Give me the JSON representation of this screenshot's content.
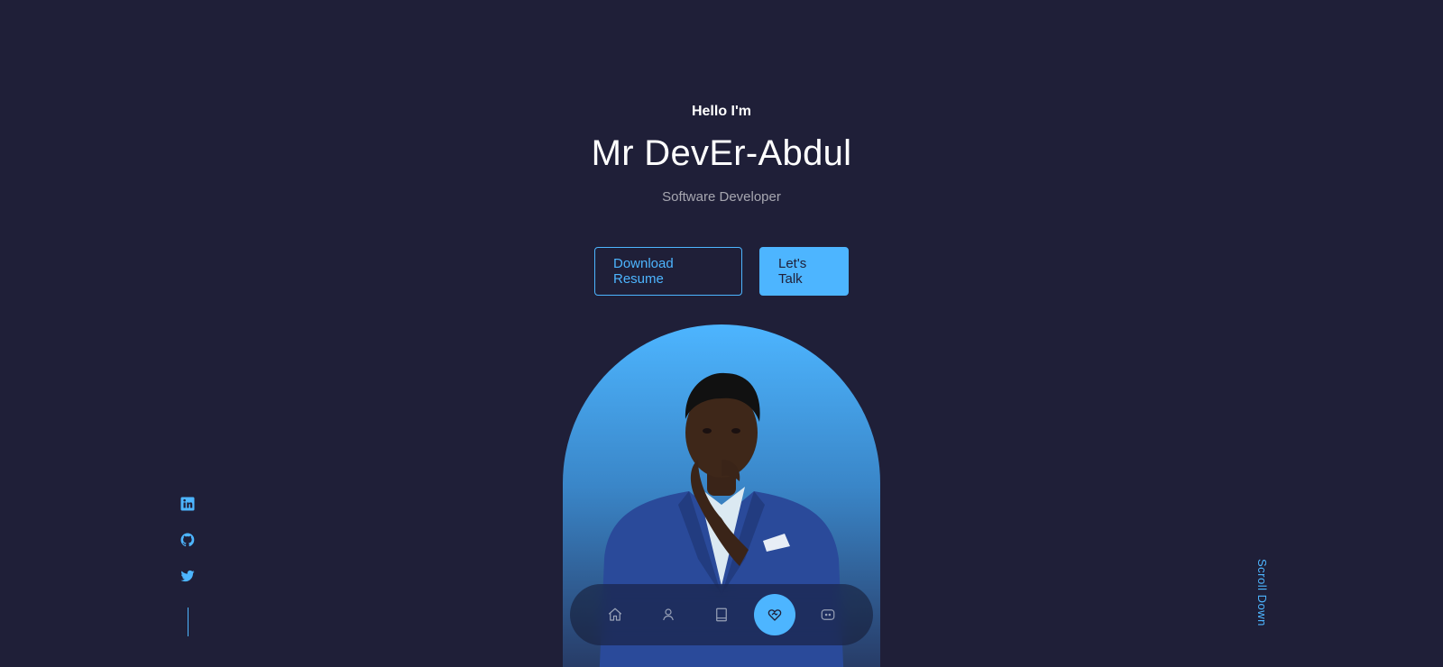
{
  "header": {
    "greeting": "Hello I'm",
    "name": "Mr DevEr-Abdul",
    "role": "Software Developer"
  },
  "cta": {
    "download_label": "Download Resume",
    "talk_label": "Let's Talk"
  },
  "socials": [
    {
      "icon": "linkedin-icon"
    },
    {
      "icon": "github-icon"
    },
    {
      "icon": "twitter-icon"
    }
  ],
  "scroll_down": "Scroll Down",
  "nav": {
    "items": [
      {
        "icon": "home-icon",
        "active": false
      },
      {
        "icon": "user-icon",
        "active": false
      },
      {
        "icon": "book-icon",
        "active": false
      },
      {
        "icon": "heart-handshake-icon",
        "active": true
      },
      {
        "icon": "message-icon",
        "active": false
      }
    ]
  },
  "colors": {
    "background": "#1f1f38",
    "accent": "#4db5ff",
    "text": "#ffffff",
    "text_muted": "rgba(255,255,255,0.6)"
  }
}
